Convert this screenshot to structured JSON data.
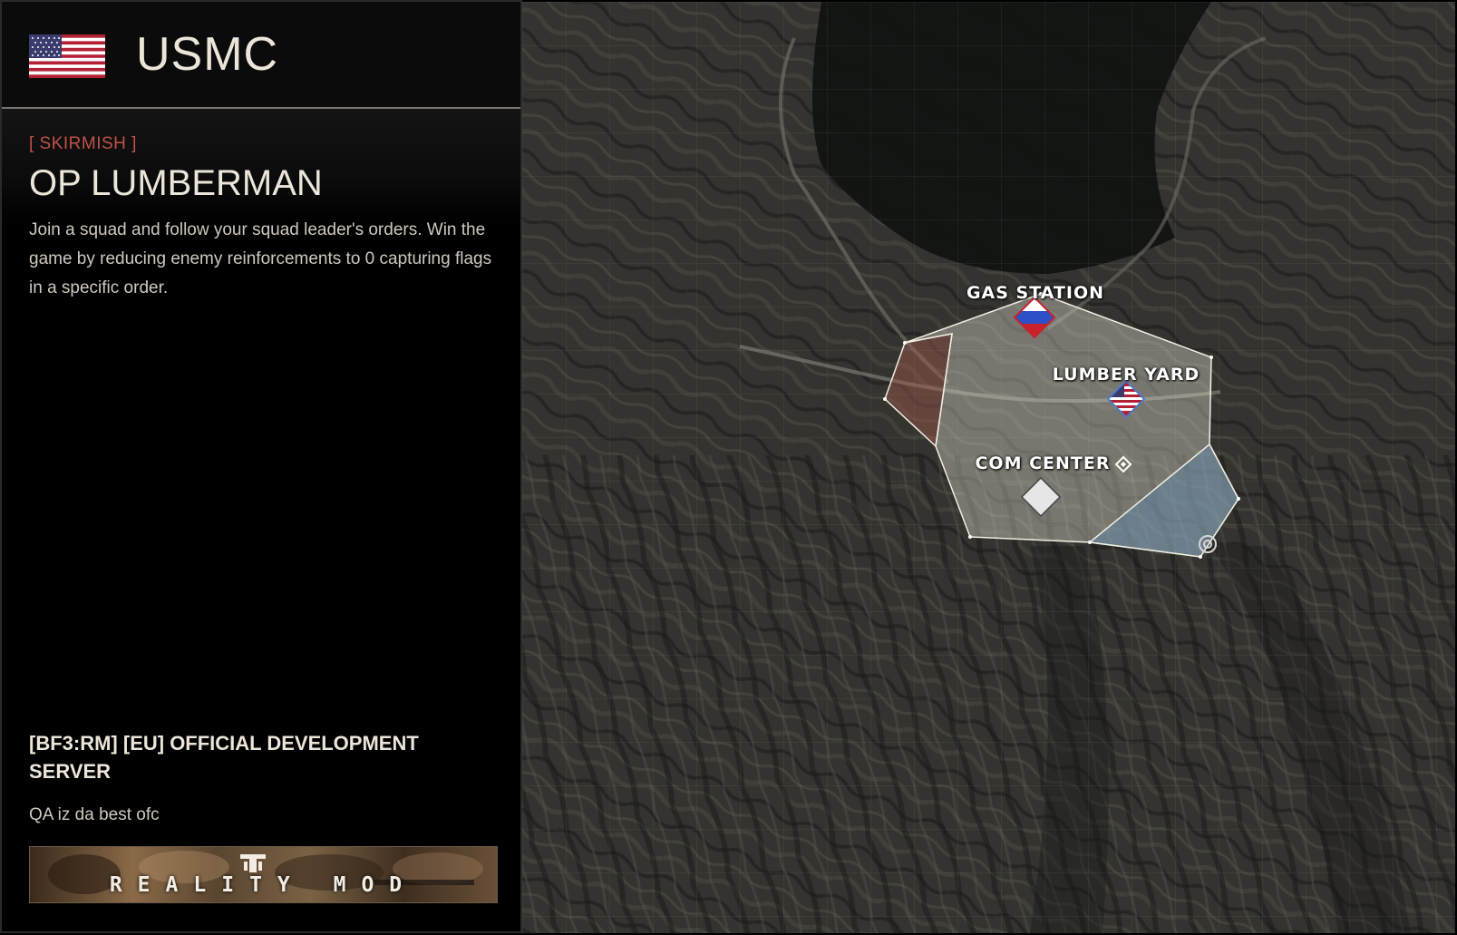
{
  "faction": {
    "name": "USMC",
    "flag_icon": "us-flag-icon"
  },
  "mode": {
    "tag": "[ SKIRMISH ]",
    "map_name": "OP LUMBERMAN",
    "description": "Join a squad and follow your squad leader's orders. Win the game by reducing enemy reinforcements to 0 capturing flags in a specific order."
  },
  "server": {
    "name": "[BF3:RM] [EU] OFFICIAL DEVELOPMENT SERVER",
    "description": "QA iz da best ofc"
  },
  "banner": {
    "text": "REALITY MOD",
    "logo_icon": "reality-mod-logo-icon"
  },
  "map": {
    "objectives": [
      {
        "id": "gas-station",
        "label": "GAS STATION",
        "owner": "russia",
        "marker_icon": "russian-flag-icon"
      },
      {
        "id": "lumber-yard",
        "label": "LUMBER YARD",
        "owner": "usa",
        "marker_icon": "us-flag-icon"
      },
      {
        "id": "com-center",
        "label": "COM CENTER",
        "owner": "neutral",
        "marker_icon": "neutral-diamond-icon"
      }
    ],
    "colors": {
      "zone_fill": "#e8e4d6",
      "red_zone": "#a05a50",
      "blue_zone": "#5a8ab0",
      "label": "#ffffff"
    }
  }
}
